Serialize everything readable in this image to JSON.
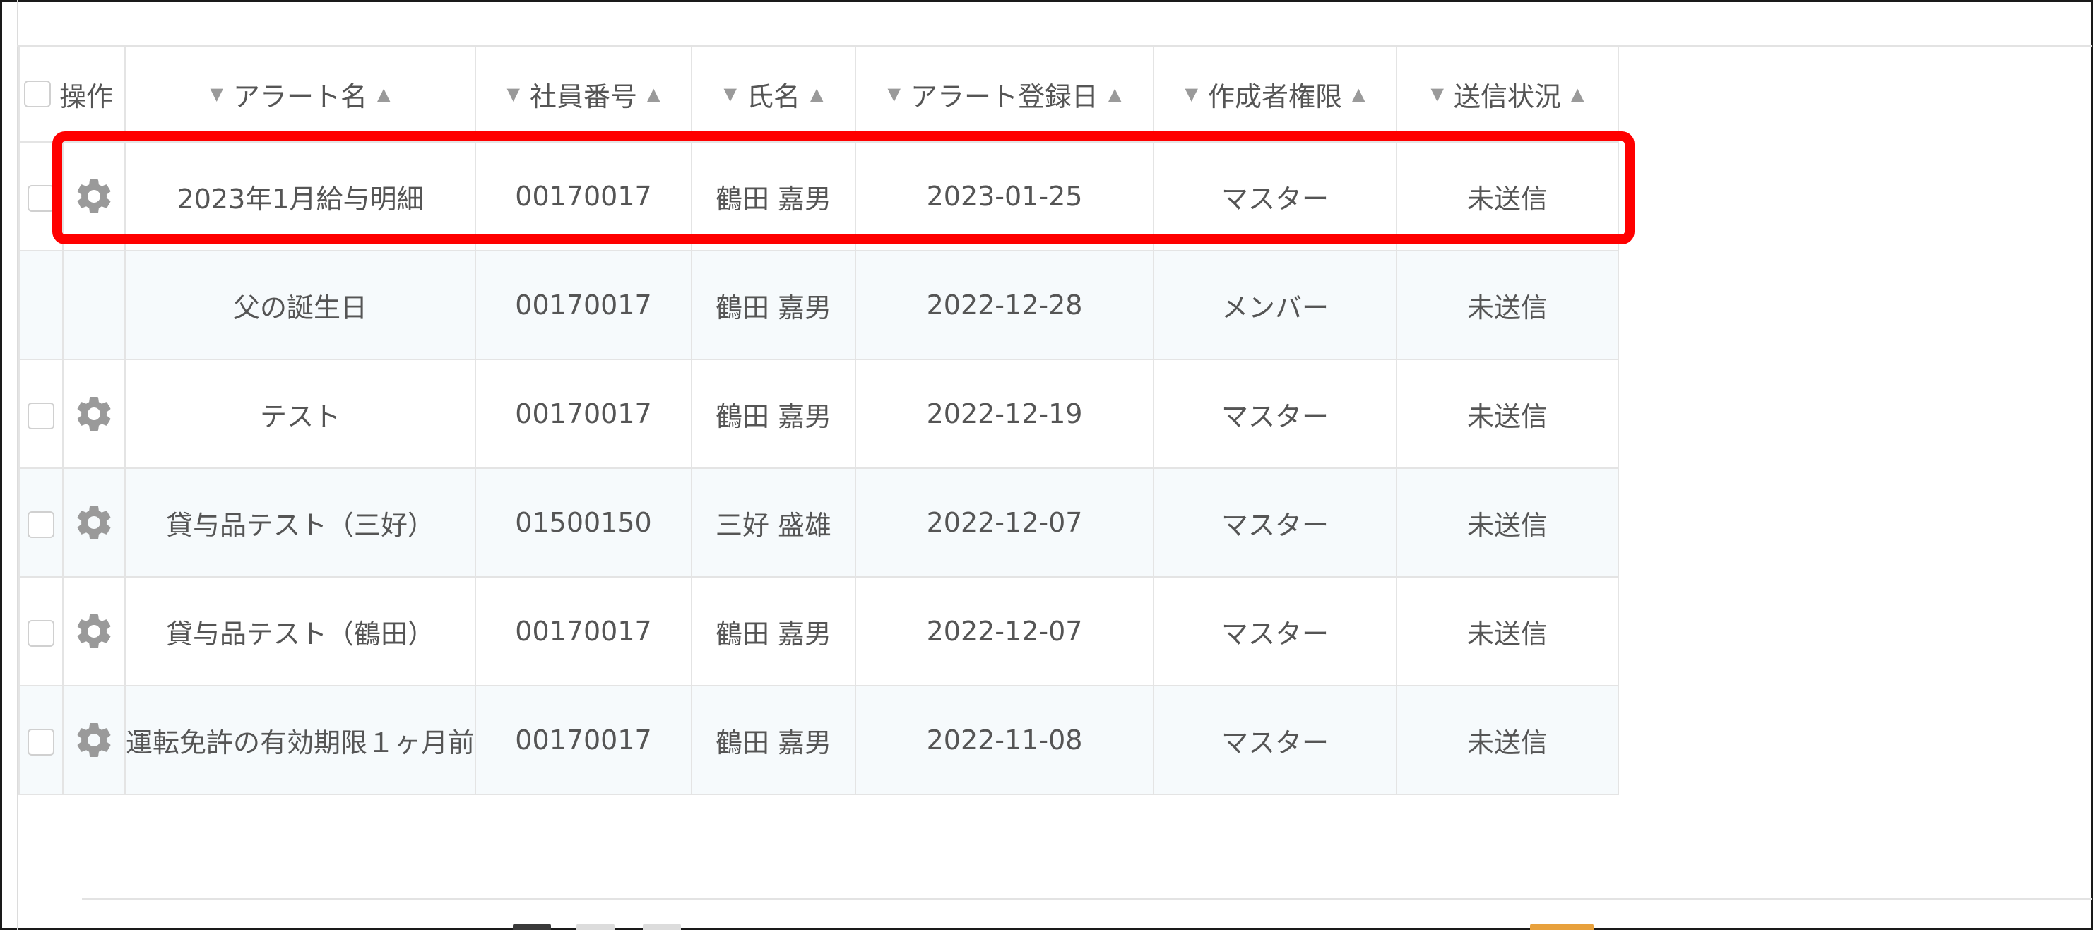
{
  "table": {
    "header": {
      "operation": "操作",
      "columns": [
        {
          "label": "アラート名"
        },
        {
          "label": "社員番号"
        },
        {
          "label": "氏名"
        },
        {
          "label": "アラート登録日"
        },
        {
          "label": "作成者権限"
        },
        {
          "label": "送信状況"
        }
      ],
      "sort_down_glyph": "▼",
      "sort_up_glyph": "▲"
    },
    "rows": [
      {
        "alert_name": "2023年1月給与明細",
        "employee_no": "00170017",
        "name": "鶴田 嘉男",
        "date": "2023-01-25",
        "role": "マスター",
        "status": "未送信",
        "has_controls": true
      },
      {
        "alert_name": "父の誕生日",
        "employee_no": "00170017",
        "name": "鶴田 嘉男",
        "date": "2022-12-28",
        "role": "メンバー",
        "status": "未送信",
        "has_controls": false
      },
      {
        "alert_name": "テスト",
        "employee_no": "00170017",
        "name": "鶴田 嘉男",
        "date": "2022-12-19",
        "role": "マスター",
        "status": "未送信",
        "has_controls": true
      },
      {
        "alert_name": "貸与品テスト（三好）",
        "employee_no": "01500150",
        "name": "三好 盛雄",
        "date": "2022-12-07",
        "role": "マスター",
        "status": "未送信",
        "has_controls": true
      },
      {
        "alert_name": "貸与品テスト（鶴田）",
        "employee_no": "00170017",
        "name": "鶴田 嘉男",
        "date": "2022-12-07",
        "role": "マスター",
        "status": "未送信",
        "has_controls": true
      },
      {
        "alert_name": "運転免許の有効期限１ヶ月前",
        "employee_no": "00170017",
        "name": "鶴田 嘉男",
        "date": "2022-11-08",
        "role": "マスター",
        "status": "未送信",
        "has_controls": true
      }
    ]
  },
  "icons": {
    "row_action": "gear-icon",
    "select": "checkbox"
  },
  "colors": {
    "highlight": "#ff0000",
    "zebra_row": "#f6fafc",
    "text": "#555555",
    "icon": "#9a9a9a"
  }
}
